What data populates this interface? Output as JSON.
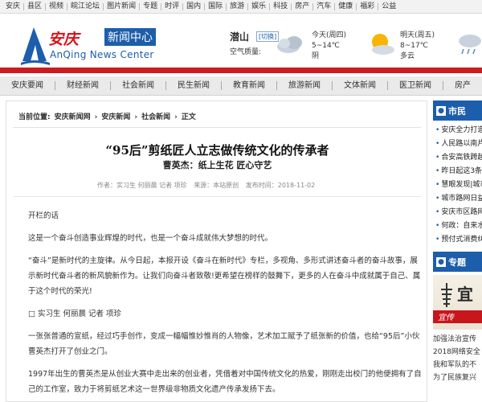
{
  "topnav": [
    "安庆",
    "县区",
    "视频",
    "皖江论坛",
    "图片新闻",
    "专题",
    "时评",
    "国内",
    "国际",
    "旅游",
    "娱乐",
    "科技",
    "房产",
    "汽车",
    "健康",
    "福彩",
    "公益"
  ],
  "logo": {
    "cn": "安庆",
    "box": "新闻中心",
    "en": "AnQing News Center"
  },
  "weather": {
    "city": "潜山",
    "switch": "[切换]",
    "air_quality": "空气质量:",
    "today": {
      "label": "今天(周四)",
      "temp": "5~14℃",
      "desc": "阴"
    },
    "tomorrow": {
      "label": "明天(周五)",
      "temp": "8~17℃",
      "desc": "多云"
    }
  },
  "mainnav": [
    "安庆要闻",
    "财经新闻",
    "社会新闻",
    "民生新闻",
    "教育新闻",
    "旅游新闻",
    "文体新闻",
    "医卫新闻",
    "房产"
  ],
  "breadcrumb": [
    "当前位置:",
    "安庆新闻网",
    "›",
    "安庆新闻",
    "›",
    "社会新闻",
    "›",
    "正文"
  ],
  "article": {
    "title": "“95后”剪纸匠人立志做传统文化的传承者",
    "subtitle": "曹英杰：纸上生花 匠心守艺",
    "meta": [
      "作者：实习生 何丽晨 记者 项珍",
      "来源：本站原创",
      "发布时间：2018-11-02"
    ],
    "paragraphs": [
      "开栏的话",
      "这是一个奋斗创造事业辉煌的时代，也是一个奋斗成就伟大梦想的时代。",
      "“奋斗”是新时代的主旋律。从今日起，本报开设《奋斗在新时代》专栏，多视角、多形式讲述奋斗者的奋斗故事，展示新时代奋斗者的新风貌新作为。让我们向奋斗者致敬!更希望在榜样的鼓舞下，更多的人在奋斗中成就属于自己、属于这个时代的荣光!",
      "□ 实习生 何丽晨 记者 项珍",
      "一张张普通的宣纸，经过巧手创作，变成一幅幅惟妙惟肖的人物像，艺术加工赋予了纸张新的价值，也给“95后”小伙曹英杰打开了创业之门。",
      "1997年出生的曹英杰是从创业大赛中走出来的创业者，凭借着对中国传统文化的热爱，刚刚走出校门的他便拥有了自己的工作室，致力于将剪纸艺术这一世界级非物质文化遗产传承发扬下去。"
    ]
  },
  "right": {
    "head1": "市民",
    "list": [
      "安庆全力打造",
      "人民路以南片",
      "合安高铁跨越",
      "昨日起这3条",
      "慧眼发现|城市",
      "城市路网日益",
      "安庆市区路网",
      "何政：自来水",
      "预付式消费纠"
    ],
    "head2": "专题",
    "img_big": "宜",
    "img_stripe": "宜传",
    "texts": [
      "加强法治宣传",
      "2018网络安全",
      "我和军队的不",
      "为了民族复兴"
    ]
  },
  "colors": {
    "brand_red": "#cf1a20",
    "brand_blue": "#1c5eab"
  }
}
